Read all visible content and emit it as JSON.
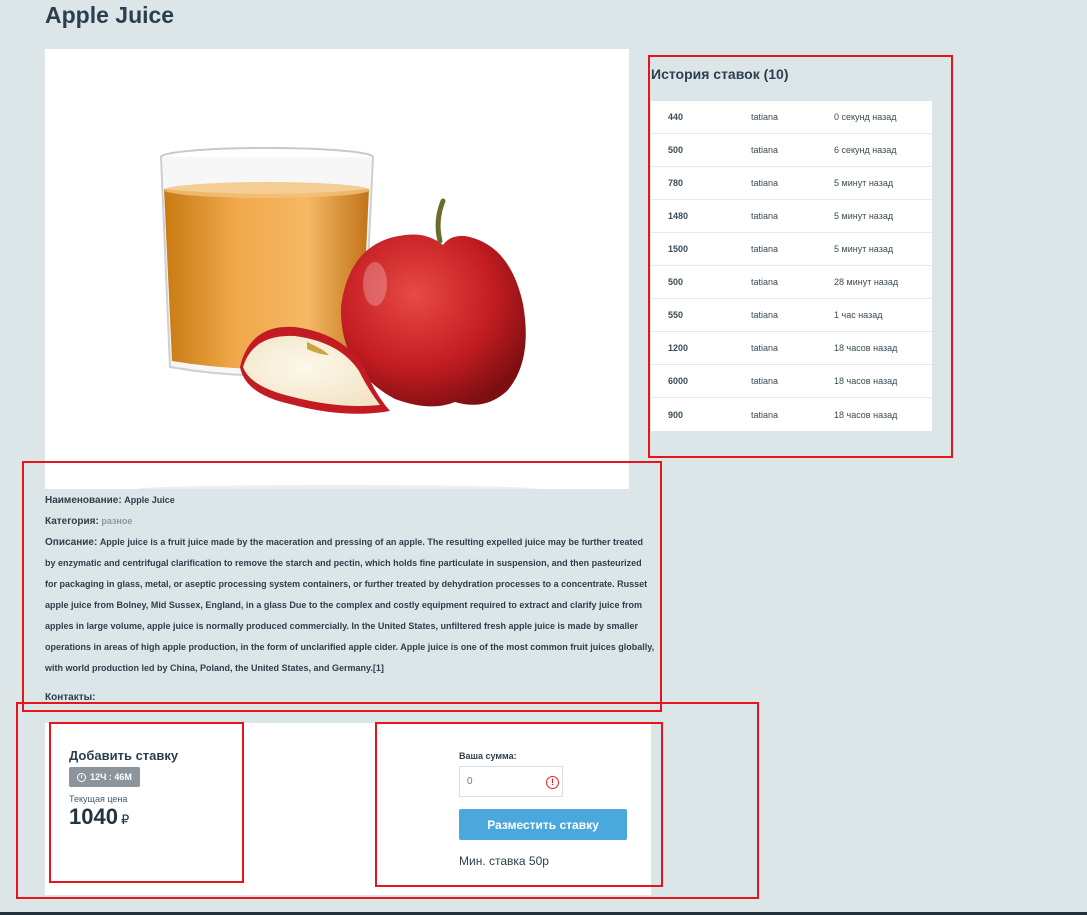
{
  "product": {
    "title": "Apple Juice"
  },
  "history": {
    "title": "История ставок (10)",
    "rows": [
      {
        "amount": "440",
        "user": "tatiana",
        "time": "0 секунд назад"
      },
      {
        "amount": "500",
        "user": "tatiana",
        "time": "6 секунд назад"
      },
      {
        "amount": "780",
        "user": "tatiana",
        "time": "5 минут назад"
      },
      {
        "amount": "1480",
        "user": "tatiana",
        "time": "5 минут назад"
      },
      {
        "amount": "1500",
        "user": "tatiana",
        "time": "5 минут назад"
      },
      {
        "amount": "500",
        "user": "tatiana",
        "time": "28 минут назад"
      },
      {
        "amount": "550",
        "user": "tatiana",
        "time": "1 час назад"
      },
      {
        "amount": "1200",
        "user": "tatiana",
        "time": "18 часов назад"
      },
      {
        "amount": "6000",
        "user": "tatiana",
        "time": "18 часов назад"
      },
      {
        "amount": "900",
        "user": "tatiana",
        "time": "18 часов назад"
      }
    ]
  },
  "details": {
    "name_label": "Наименование:",
    "name_value": "Apple Juice",
    "category_label": "Категория:",
    "category_value": "разное",
    "description_label": "Описание:",
    "description": "Apple juice is a fruit juice made by the maceration and pressing of an apple. The resulting expelled juice may be further treated by enzymatic and centrifugal clarification to remove the starch and pectin, which holds fine particulate in suspension, and then pasteurized for packaging in glass, metal, or aseptic processing system containers, or further treated by dehydration processes to a concentrate. Russet apple juice from Bolney, Mid Sussex, England, in a glass Due to the complex and costly equipment required to extract and clarify juice from apples in large volume, apple juice is normally produced commercially. In the United States, unfiltered fresh apple juice is made by smaller operations in areas of high apple production, in the form of unclarified apple cider. Apple juice is one of the most common fruit juices globally, with world production led by China, Poland, the United States, and Germany.[1]",
    "contacts_label": "Контакты:"
  },
  "bid": {
    "title": "Добавить ставку",
    "timer": "12Ч : 46М",
    "current_price_label": "Текущая цена",
    "current_price": "1040",
    "currency": "₽",
    "amount_label": "Ваша сумма:",
    "amount_value": "0",
    "submit_label": "Разместить ставку",
    "min_bid": "Мин. ставка 50р"
  },
  "colors": {
    "background": "#dce6e9",
    "accent_button": "#4aa8dc",
    "annotation": "#e8141b",
    "timer_badge": "#8b959b"
  }
}
